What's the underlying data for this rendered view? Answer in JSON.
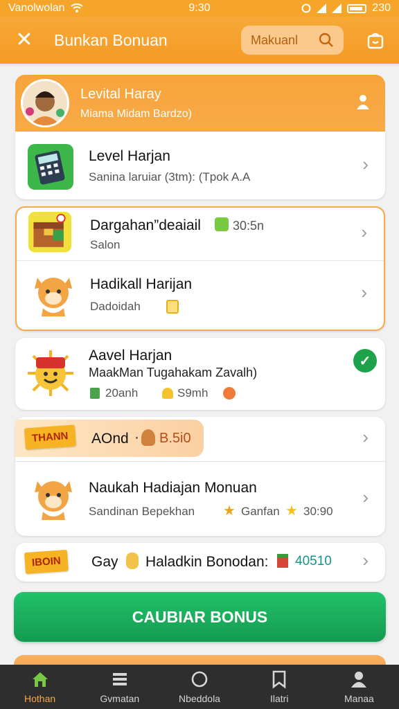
{
  "status": {
    "carrier": "Vanolwolan",
    "time": "9:30",
    "battery_text": "230"
  },
  "header": {
    "title": "Bunkan Bonuan",
    "search_label": "Makuanl"
  },
  "profile": {
    "name": "Levital Haray",
    "subtitle": "Miama Midam Bardzo)"
  },
  "rows": [
    {
      "title": "Level Harjan",
      "subtitle": "Sanina laruiar (3tm): (Tpok A.A"
    },
    {
      "title": "Dargahan”deaiail",
      "subtitle": "Salon",
      "badge": "30:5n"
    },
    {
      "title": "Hadikall Harijan",
      "subtitle": "Dadoidah"
    },
    {
      "title": "Aavel Harjan",
      "subtitle": "MaakMan Tugahakam Zavalh)",
      "meta1": "20anh",
      "meta2": "S9mh"
    },
    {
      "ribbon": "THANN",
      "title": "AOnd",
      "amount": "B.5i0"
    },
    {
      "title": "Naukah Hadiajan Monuan",
      "subtitle": "Sandinan Bepekhan",
      "meta1": "Ganfan",
      "meta2": "30:90"
    },
    {
      "ribbon": "IBOIN",
      "title_a": "Gay",
      "title_b": "Haladkin Bonodan:",
      "value": "40510"
    }
  ],
  "cta": {
    "label": "CAUBIAR BONUS"
  },
  "nav": [
    {
      "label": "Hothan",
      "icon": "home-icon"
    },
    {
      "label": "Gvmatan",
      "icon": "list-icon"
    },
    {
      "label": "Nbeddola",
      "icon": "circle-icon"
    },
    {
      "label": "Ilatri",
      "icon": "bookmark-icon"
    },
    {
      "label": "Manaa",
      "icon": "profile-icon"
    }
  ],
  "colors": {
    "accent": "#f4a52a",
    "cta": "#1fa34a",
    "navbar": "#2e2e2e"
  }
}
